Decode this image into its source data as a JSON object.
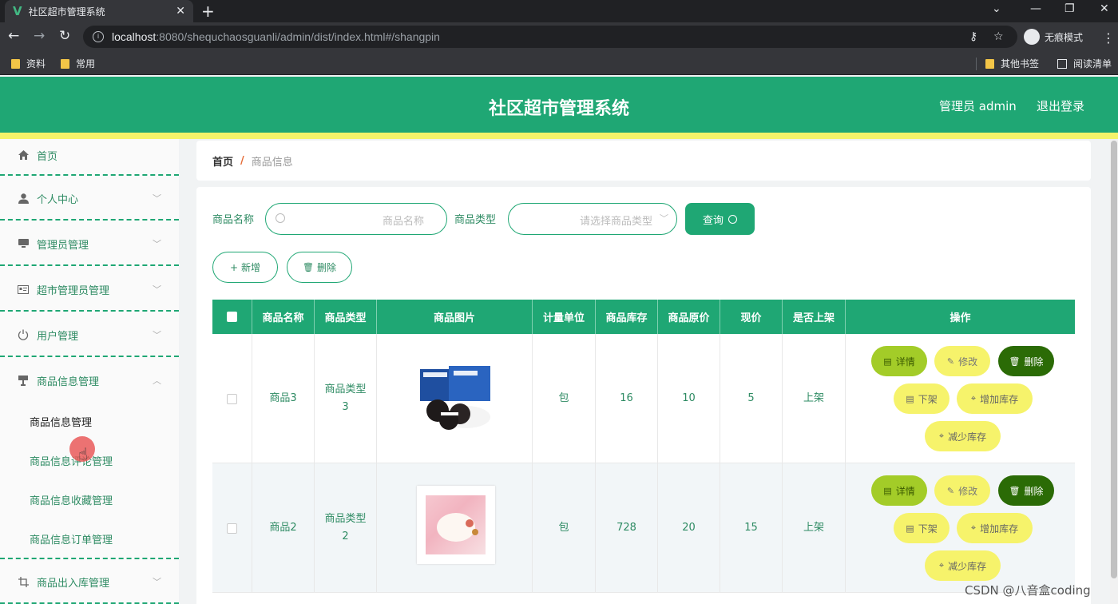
{
  "browser": {
    "tab_title": "社区超市管理系统",
    "url_host": "localhost",
    "url_rest": ":8080/shequchaosguanli/admin/dist/index.html#/shangpin",
    "incognito_label": "无痕模式",
    "bookmarks": [
      "资料",
      "常用"
    ],
    "bookmarks_right": [
      "其他书签",
      "阅读清单"
    ]
  },
  "header": {
    "title": "社区超市管理系统",
    "user": "管理员 admin",
    "logout": "退出登录"
  },
  "sidebar": {
    "items": [
      {
        "label": "首页",
        "icon": "home-icon"
      },
      {
        "label": "个人中心",
        "icon": "user-icon"
      },
      {
        "label": "管理员管理",
        "icon": "monitor-icon"
      },
      {
        "label": "超市管理员管理",
        "icon": "id-card-icon"
      },
      {
        "label": "用户管理",
        "icon": "power-icon"
      },
      {
        "label": "商品信息管理",
        "icon": "shop-icon"
      },
      {
        "label": "商品出入库管理",
        "icon": "crop-icon"
      }
    ],
    "submenu": [
      "商品信息管理",
      "商品信息评论管理",
      "商品信息收藏管理",
      "商品信息订单管理"
    ]
  },
  "breadcrumb": {
    "home": "首页",
    "separator": "/",
    "current": "商品信息"
  },
  "search": {
    "name_label": "商品名称",
    "name_placeholder": "商品名称",
    "type_label": "商品类型",
    "type_placeholder": "请选择商品类型",
    "query_button": "查询"
  },
  "toolbar": {
    "add_button": "新增",
    "delete_button": "删除"
  },
  "table": {
    "headers": [
      "商品名称",
      "商品类型",
      "商品图片",
      "计量单位",
      "商品库存",
      "商品原价",
      "现价",
      "是否上架",
      "操作"
    ],
    "rows": [
      {
        "name": "商品3",
        "type": "商品类型3",
        "image": "oreo-product-image",
        "unit": "包",
        "stock": "16",
        "original_price": "10",
        "price": "5",
        "on_sale": "上架"
      },
      {
        "name": "商品2",
        "type": "商品类型2",
        "image": "yogurt-product-image",
        "unit": "包",
        "stock": "728",
        "original_price": "20",
        "price": "15",
        "on_sale": "上架"
      }
    ],
    "actions": {
      "detail": "详情",
      "edit": "修改",
      "delete": "删除",
      "off_shelf": "下架",
      "add_stock": "增加库存",
      "reduce_stock": "减少库存"
    }
  },
  "watermark": "CSDN @八音盒coding",
  "colors": {
    "primary": "#1fa774",
    "accent_yellow": "#f4f36a",
    "delete_green": "#2b6b06",
    "detail_green": "#a3cc28"
  }
}
